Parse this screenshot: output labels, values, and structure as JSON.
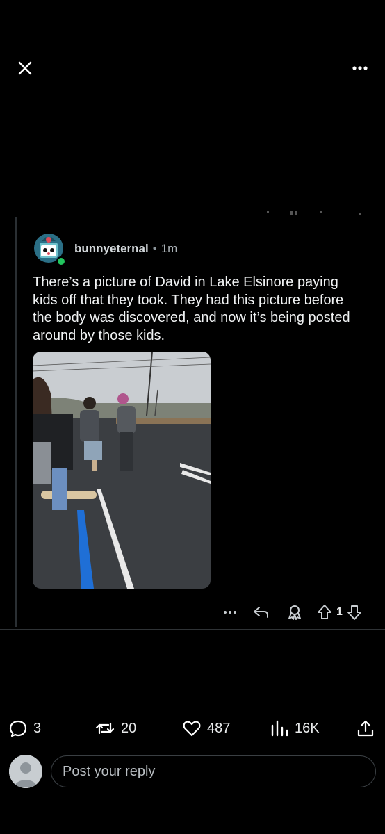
{
  "header": {
    "close_icon": "close-icon",
    "more_icon": "more-horizontal-icon"
  },
  "comment": {
    "username": "bunnyeternal",
    "separator": "•",
    "time": "1m",
    "avatar_icon": "avatar-icon",
    "online_color": "#22c55e",
    "text": "There’s a picture of David in Lake Elsinore paying kids off that they took. They had this picture before the body was discovered, and now it’s being posted around by those kids.",
    "actions": {
      "more_icon": "more-horizontal-icon",
      "reply_icon": "reply-arrow-icon",
      "award_icon": "award-icon",
      "upvote_icon": "upvote-arrow-icon",
      "vote_count": "1",
      "downvote_icon": "downvote-arrow-icon"
    }
  },
  "engagement": {
    "replies": "3",
    "reposts": "20",
    "likes": "487",
    "views": "16K",
    "share_icon": "share-icon"
  },
  "reply_box": {
    "placeholder": "Post your reply"
  },
  "colors": {
    "background": "#000000",
    "text": "#e7e9ea",
    "divider": "#2f3336"
  }
}
